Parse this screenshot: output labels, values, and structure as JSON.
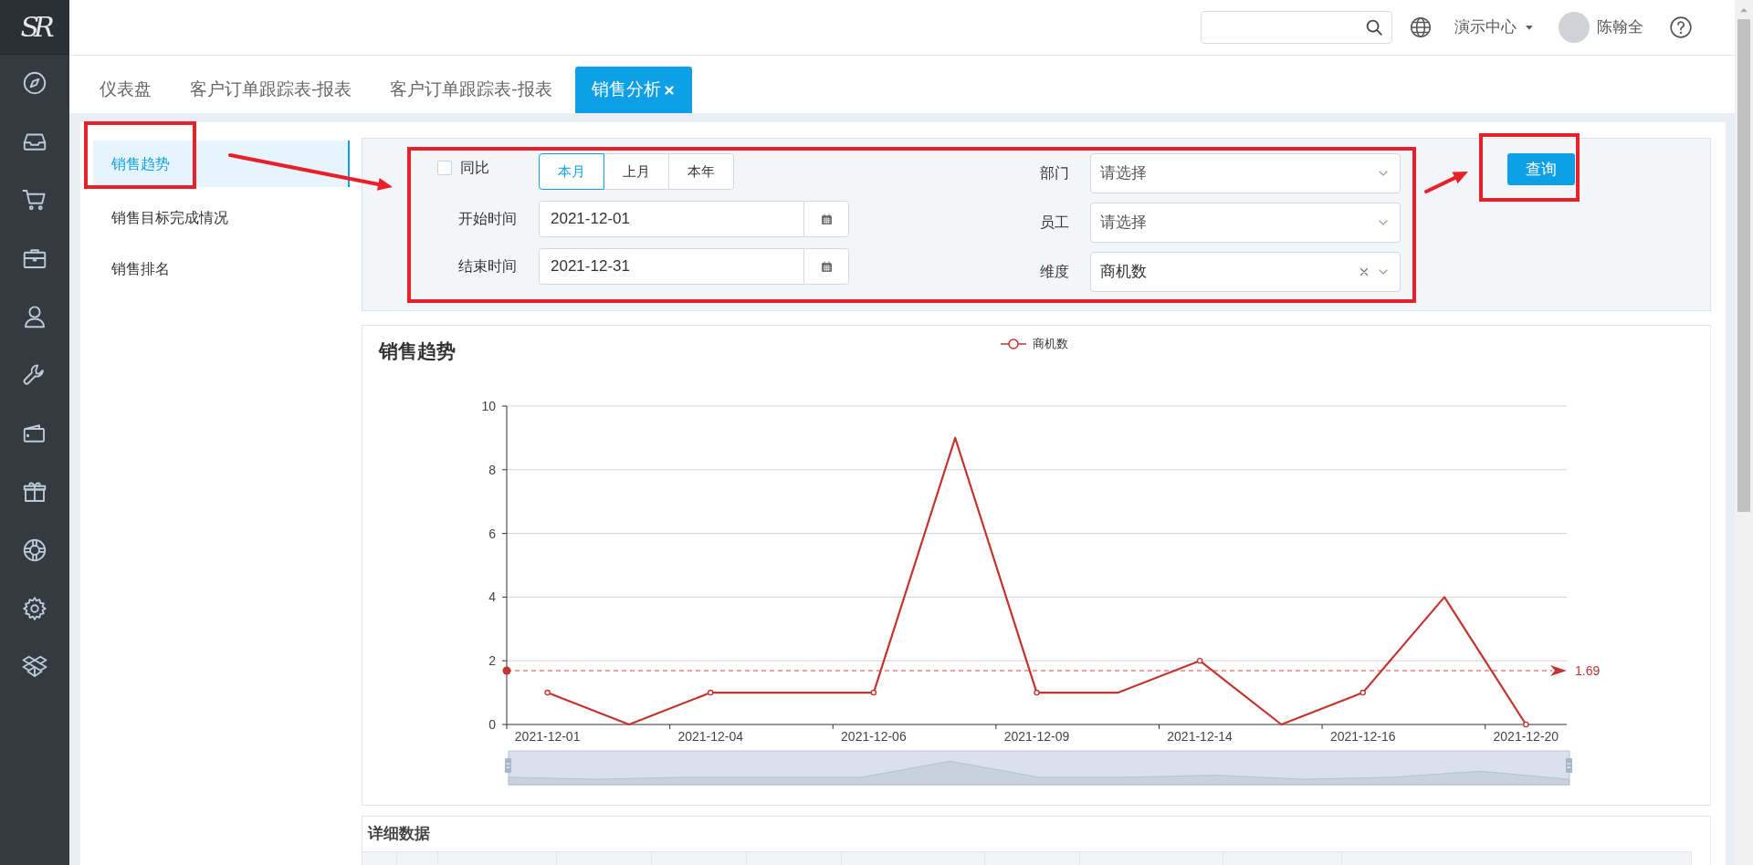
{
  "sidebar": {
    "logo": "SR"
  },
  "top_bar": {
    "workspace": "演示中心",
    "user": "陈翰全"
  },
  "tabs": [
    {
      "label": "仪表盘",
      "selected": false
    },
    {
      "label": "客户订单跟踪表-报表",
      "selected": false
    },
    {
      "label": "客户订单跟踪表-报表",
      "selected": false
    },
    {
      "label": "销售分析",
      "selected": true
    }
  ],
  "side_menu": [
    {
      "label": "销售趋势",
      "selected": true
    },
    {
      "label": "销售目标完成情况",
      "selected": false
    },
    {
      "label": "销售排名",
      "selected": false
    }
  ],
  "filters": {
    "compare": {
      "label": "同比",
      "checked": false
    },
    "periods": [
      {
        "label": "本月",
        "selected": true
      },
      {
        "label": "上月",
        "selected": false
      },
      {
        "label": "本年",
        "selected": false
      }
    ],
    "start_date": {
      "label": "开始时间",
      "value": "2021-12-01"
    },
    "end_date": {
      "label": "结束时间",
      "value": "2021-12-31"
    },
    "department": {
      "label": "部门",
      "placeholder": "请选择"
    },
    "employee": {
      "label": "员工",
      "placeholder": "请选择"
    },
    "dimension": {
      "label": "维度",
      "value": "商机数"
    },
    "query_button": "查询"
  },
  "chart": {
    "title": "销售趋势",
    "chart_data": {
      "type": "line",
      "categories": [
        "2021-12-01",
        null,
        "2021-12-04",
        null,
        "2021-12-06",
        null,
        "2021-12-09",
        null,
        "2021-12-14",
        null,
        "2021-12-16",
        null,
        "2021-12-20"
      ],
      "series": [
        {
          "name": "商机数",
          "color": "#c23531",
          "values": [
            1,
            0,
            1,
            1,
            1,
            9,
            1,
            1,
            2,
            0,
            1,
            4,
            0
          ]
        }
      ],
      "ylim": [
        0,
        10
      ],
      "yticks": [
        0,
        2,
        4,
        6,
        8,
        10
      ],
      "grid": true,
      "ref_lines": [
        {
          "axis": "y",
          "value": 1.69,
          "label": "1.69"
        }
      ]
    }
  },
  "details": {
    "title": "详细数据"
  }
}
